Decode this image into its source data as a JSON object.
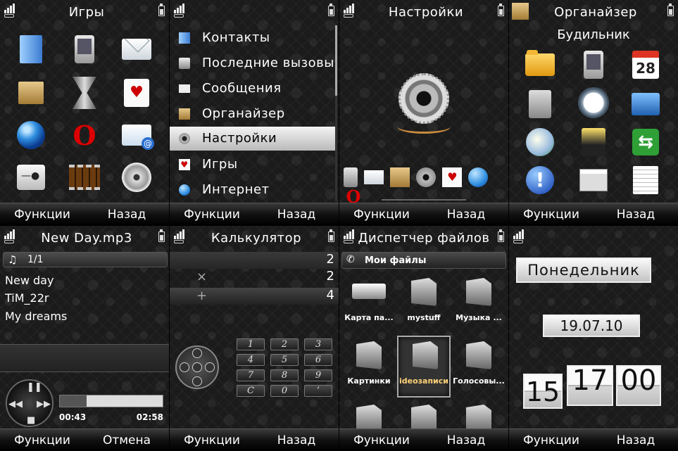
{
  "softkeys": {
    "functions": "Функции",
    "back": "Назад",
    "cancel": "Отмена"
  },
  "screens": {
    "games": {
      "title": "Игры"
    },
    "menu": {
      "items": [
        {
          "label": "Контакты",
          "icon": "contacts-icon"
        },
        {
          "label": "Последние вызовы",
          "icon": "phone-icon"
        },
        {
          "label": "Сообщения",
          "icon": "envelope-icon"
        },
        {
          "label": "Органайзер",
          "icon": "organizer-icon"
        },
        {
          "label": "Настройки",
          "icon": "settings-icon",
          "selected": true
        },
        {
          "label": "Игры",
          "icon": "cards-icon"
        },
        {
          "label": "Интернет",
          "icon": "globe-icon"
        }
      ]
    },
    "settings": {
      "title": "Настройки"
    },
    "organizer": {
      "title": "Органайзер",
      "subtitle": "Будильник"
    },
    "player": {
      "title": "New Day.mp3",
      "counter": "1/1",
      "tracks": [
        "New day",
        "TiM_22r",
        "My dreams"
      ],
      "elapsed": "00:43",
      "total": "02:58",
      "progress": 0.26
    },
    "calculator": {
      "title": "Калькулятор",
      "operand1": "2",
      "operator": "×",
      "operand2": "2",
      "result_op": "+",
      "result": "4",
      "keys": [
        "1",
        "2",
        "3",
        "4",
        "5",
        "6",
        "7",
        "8",
        "9",
        "C",
        "0",
        "’"
      ]
    },
    "files": {
      "title": "Диспетчер файлов",
      "bar_label": "Мои файлы",
      "items": [
        {
          "label": "Карта па..."
        },
        {
          "label": "mystuff"
        },
        {
          "label": "Музыка ..."
        },
        {
          "label": "Картинки"
        },
        {
          "label": "ideoзаписи",
          "selected": true
        },
        {
          "label": "Голосовы..."
        }
      ]
    },
    "clock": {
      "day": "Понедельник",
      "date": "19.07.10",
      "hour": "15",
      "minute": "17",
      "second": "00"
    }
  }
}
